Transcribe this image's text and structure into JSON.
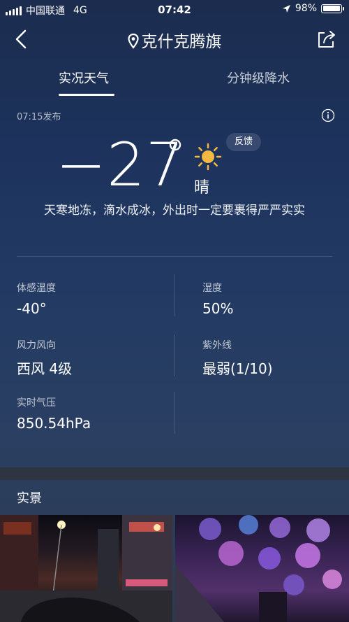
{
  "status_bar": {
    "carrier": "中国联通",
    "network": "4G",
    "time": "07:42",
    "battery": "98%",
    "battery_level": 0.98
  },
  "nav": {
    "title": "克什克腾旗",
    "back_icon": "chevron-left-icon",
    "location_icon": "pin-icon",
    "share_icon": "share-icon"
  },
  "tabs": {
    "current": "实况天气",
    "minute": "分钟级降水"
  },
  "weather": {
    "publish_time": "07:15发布",
    "temperature": "−27",
    "condition": "晴",
    "condition_icon": "sun-icon",
    "feedback_label": "反馈",
    "tip": "天寒地冻，滴水成冰，外出时一定要裹得严严实实"
  },
  "details": {
    "feels_like": {
      "label": "体感温度",
      "value": "-40°"
    },
    "humidity": {
      "label": "湿度",
      "value": "50%"
    },
    "wind": {
      "label": "风力风向",
      "value": "西风 4级"
    },
    "uv": {
      "label": "紫外线",
      "value": "最弱(1/10)"
    },
    "pressure": {
      "label": "实时气压",
      "value": "850.54hPa"
    }
  },
  "live_scene": {
    "title": "实景"
  },
  "colors": {
    "background_top": "#1b2c4e",
    "background_bottom": "#2d3a4d",
    "sun": "#f5b942"
  }
}
